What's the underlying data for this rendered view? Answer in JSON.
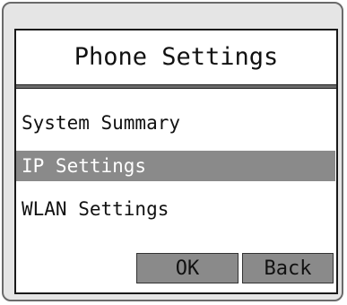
{
  "title": "Phone Settings",
  "menu": {
    "items": [
      {
        "label": "System Summary",
        "selected": false
      },
      {
        "label": "IP Settings",
        "selected": true
      },
      {
        "label": "WLAN Settings",
        "selected": false
      }
    ]
  },
  "buttons": {
    "ok_label": "OK",
    "back_label": "Back"
  },
  "colors": {
    "selection": "#8a8a8a",
    "frame": "#e5e5e5",
    "screen": "#ffffff"
  }
}
